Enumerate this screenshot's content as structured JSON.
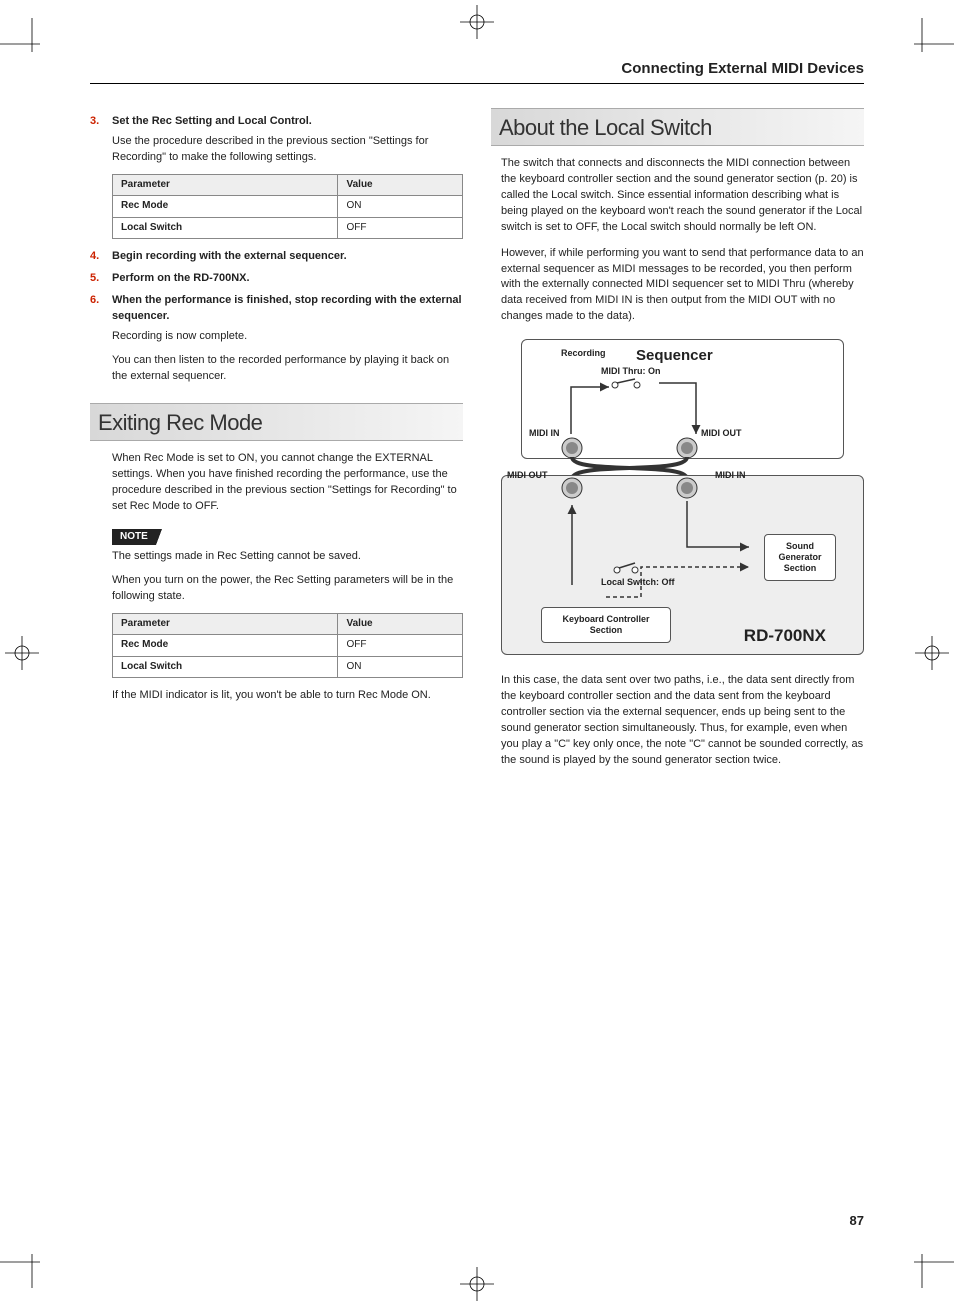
{
  "running_head": "Connecting External MIDI Devices",
  "steps": {
    "s3": {
      "num": "3.",
      "title": "Set the Rec Setting and Local Control.",
      "para": "Use the procedure described in the previous section \"Settings for Recording\" to make the following settings."
    },
    "s4": {
      "num": "4.",
      "title": "Begin recording with the external sequencer."
    },
    "s5": {
      "num": "5.",
      "title": "Perform on the RD-700NX."
    },
    "s6": {
      "num": "6.",
      "title": "When the performance is finished, stop recording with the external sequencer.",
      "p1": "Recording is now complete.",
      "p2": "You can then listen to the recorded performance by playing it back on the external sequencer."
    }
  },
  "table1": {
    "h1": "Parameter",
    "h2": "Value",
    "rows": [
      {
        "p": "Rec Mode",
        "v": "ON"
      },
      {
        "p": "Local Switch",
        "v": "OFF"
      }
    ]
  },
  "exit": {
    "heading": "Exiting Rec Mode",
    "p1": "When Rec Mode is set to ON, you cannot change the EXTERNAL settings. When you have finished recording the performance, use the procedure described in the previous section \"Settings for Recording\" to set Rec Mode to OFF.",
    "note_label": "NOTE",
    "note_p1": "The settings made in Rec Setting cannot be saved.",
    "note_p2": "When you turn on the power, the Rec Setting parameters will be in the following state.",
    "p_after": "If the MIDI indicator is lit, you won't be able to turn Rec Mode ON."
  },
  "table2": {
    "h1": "Parameter",
    "h2": "Value",
    "rows": [
      {
        "p": "Rec Mode",
        "v": "OFF"
      },
      {
        "p": "Local Switch",
        "v": "ON"
      }
    ]
  },
  "local": {
    "heading": "About the Local Switch",
    "p1": "The switch that connects and disconnects the MIDI connection between the keyboard controller section and the sound generator section (p. 20) is called the Local switch. Since essential information describing what is being played on the keyboard won't reach the sound generator if the Local switch is set to OFF, the Local switch should normally be left ON.",
    "p2": "However, if while performing you want to send that performance data to an external sequencer as MIDI messages to be recorded, you then perform with the externally connected MIDI sequencer set to MIDI Thru (whereby data received from MIDI IN is then output from the MIDI OUT with no changes made to the data).",
    "p_after": "In this case, the data sent over two paths, i.e., the data sent directly from the keyboard controller section and the data sent from the keyboard controller section via the external sequencer, ends up being sent to the sound generator section simultaneously. Thus, for example, even when you play a \"C\" key only once, the note \"C\" cannot be sounded correctly, as the sound is played by the sound generator section twice."
  },
  "diagram": {
    "recording": "Recording",
    "sequencer": "Sequencer",
    "midi_thru": "MIDI Thru: On",
    "midi_in": "MIDI IN",
    "midi_out": "MIDI OUT",
    "local_sw": "Local Switch: Off",
    "kbd": "Keyboard Controller Section",
    "sgen": "Sound Generator Section",
    "rd": "RD-700NX"
  },
  "page_number": "87"
}
